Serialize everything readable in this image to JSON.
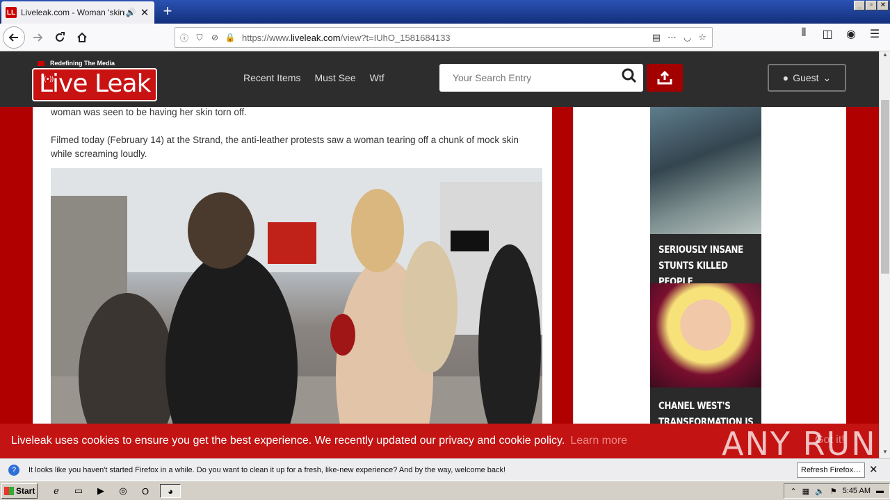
{
  "browser": {
    "tab": {
      "favicon": "LL",
      "title": "Liveleak.com - Woman 'skinned",
      "speaker_icon": "speaker-icon",
      "close": "✕"
    },
    "new_tab": "+",
    "window_controls": [
      "_",
      "▫",
      "✕"
    ],
    "url": {
      "prefix": "https://www.",
      "domain": "liveleak.com",
      "path": "/view?t=IUhO_1581684133"
    },
    "actions": [
      "⋯"
    ]
  },
  "site": {
    "logo": {
      "tagline": "Redefining The Media",
      "name": "Live Leak"
    },
    "nav": [
      "Recent Items",
      "Must See",
      "Wtf"
    ],
    "search": {
      "placeholder": "Your Search Entry"
    },
    "guest_label": "Guest"
  },
  "article": {
    "paragraph_1": "woman was seen to be having her skin torn off.",
    "paragraph_2": "Filmed today (February 14) at the Strand, the anti-leather protests saw a woman tearing off a chunk of mock skin while screaming loudly."
  },
  "sidebar": {
    "cards": [
      {
        "caption": "SERIOUSLY INSANE STUNTS KILLED PEOPLE"
      },
      {
        "caption": "CHANEL WEST'S TRANSFORMATION IS"
      }
    ]
  },
  "cookie": {
    "text": "Liveleak uses cookies to ensure you get the best experience. We recently updated our privacy and cookie policy.",
    "learn_more": "Learn more",
    "got_it": "Got it!"
  },
  "watermark": "ANY RUN",
  "notification": {
    "text": "It looks like you haven't started Firefox in a while. Do you want to clean it up for a fresh, like-new experience? And by the way, welcome back!",
    "button": "Refresh Firefox…"
  },
  "taskbar": {
    "start": "Start",
    "clock": "5:45 AM"
  }
}
